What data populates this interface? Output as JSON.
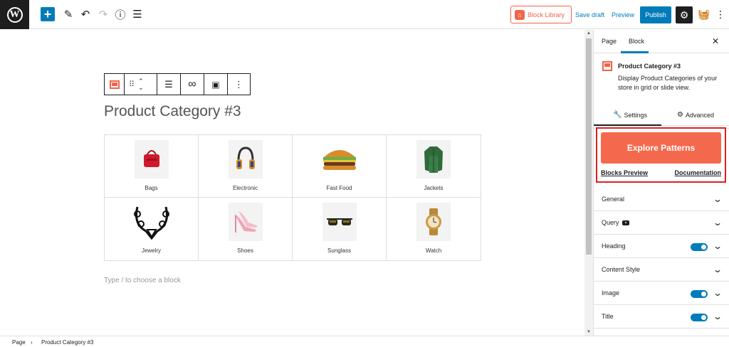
{
  "toolbar": {
    "block_library_label": "Block Library",
    "save_draft_label": "Save draft",
    "preview_label": "Preview",
    "publish_label": "Publish"
  },
  "editor": {
    "block_title": "Product Category #3",
    "placeholder": "Type / to choose a block",
    "categories": [
      {
        "name": "Bags",
        "icon": "bag-icon"
      },
      {
        "name": "Electronic",
        "icon": "headphones-icon"
      },
      {
        "name": "Fast Food",
        "icon": "burger-icon"
      },
      {
        "name": "Jackets",
        "icon": "jacket-icon"
      },
      {
        "name": "Jewelry",
        "icon": "necklace-icon"
      },
      {
        "name": "Shoes",
        "icon": "heels-icon"
      },
      {
        "name": "Sunglass",
        "icon": "sunglasses-icon"
      },
      {
        "name": "Watch",
        "icon": "watch-icon"
      }
    ]
  },
  "sidebar": {
    "tabs": [
      "Page",
      "Block"
    ],
    "block_name": "Product Category #3",
    "block_description": "Display Product Categories of your store in grid or slide view.",
    "settings_tab": "Settings",
    "advanced_tab": "Advanced",
    "explore_label": "Explore Patterns",
    "blocks_preview_label": "Blocks Preview",
    "documentation_label": "Documentation",
    "panels": [
      {
        "label": "General",
        "toggle": false
      },
      {
        "label": "Query",
        "toggle": false
      },
      {
        "label": "Heading",
        "toggle": true
      },
      {
        "label": "Content Style",
        "toggle": false
      },
      {
        "label": "Image",
        "toggle": true
      },
      {
        "label": "Title",
        "toggle": true
      }
    ]
  },
  "footer": {
    "crumb_page": "Page",
    "crumb_block": "Product Category #3"
  },
  "colors": {
    "accent": "#007cba",
    "brand_orange": "#f4694d",
    "highlight_red": "#e02020"
  }
}
